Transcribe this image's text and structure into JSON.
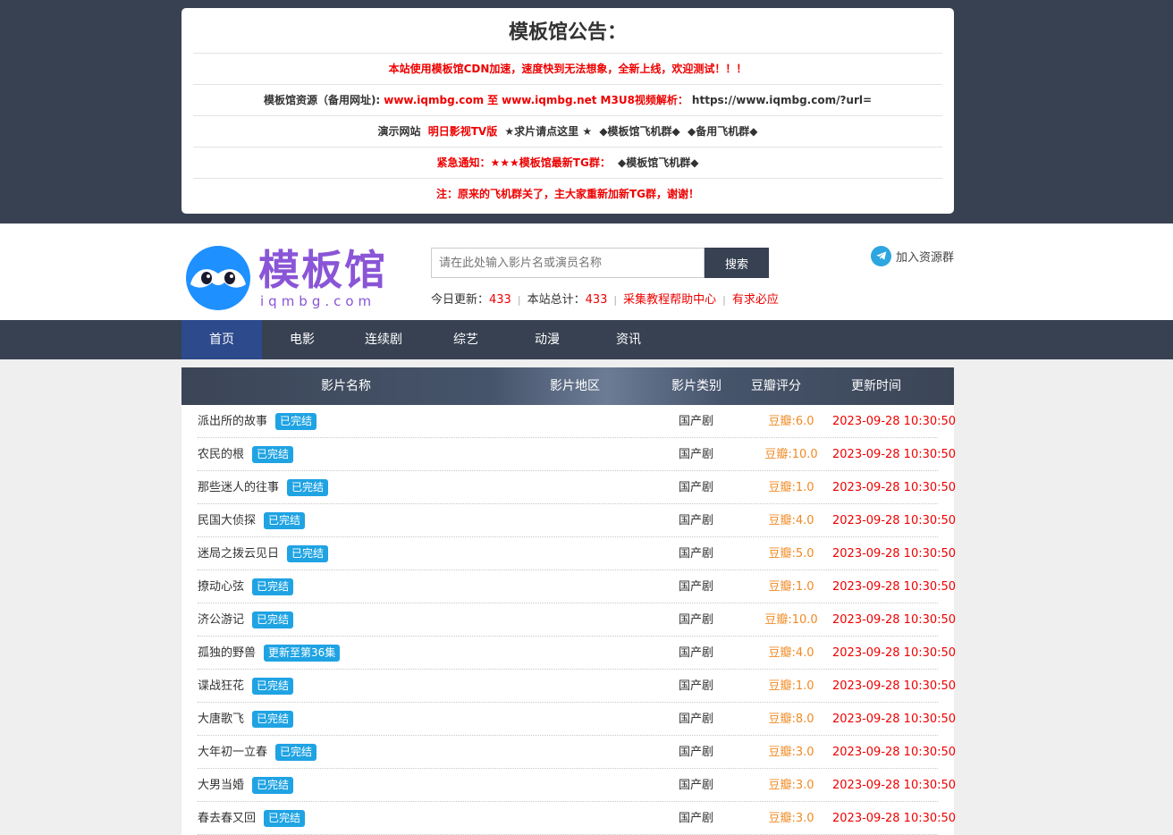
{
  "notice": {
    "title": "模板馆公告：",
    "line1": "本站使用模板馆CDN加速，速度快到无法想象，全新上线，欢迎测试！！！",
    "line2": {
      "prefix": "模板馆资源（备用网址):",
      "url1": "www.iqmbg.com",
      "to": "至",
      "url2": "www.iqmbg.net",
      "m3u8": "M3U8视频解析：",
      "parse_url": "https://www.iqmbg.com/?url="
    },
    "line3": {
      "label": "演示网站",
      "site": "明日影视TV版",
      "request": "★求片请点这里 ★",
      "group1": "◆模板馆飞机群◆",
      "group2": "◆备用飞机群◆"
    },
    "line4": {
      "urgent": "紧急通知：★★★模板馆最新TG群：",
      "group": "◆模板馆飞机群◆"
    },
    "line5": "注：原来的飞机群关了，主大家重新加新TG群，谢谢！"
  },
  "header": {
    "logo_text": "模板馆",
    "logo_sub": "iqmbg.com",
    "search_placeholder": "请在此处输入影片名或演员名称",
    "search_button": "搜索",
    "today_label": "今日更新：",
    "today_count": "433",
    "total_label": "本站总计：",
    "total_count": "433",
    "help_link": "采集教程帮助中心",
    "request_link": "有求必应",
    "join_label": "加入资源群"
  },
  "nav": {
    "items": [
      "首页",
      "电影",
      "连续剧",
      "综艺",
      "动漫",
      "资讯"
    ]
  },
  "table": {
    "headers": {
      "name": "影片名称",
      "region": "影片地区",
      "category": "影片类别",
      "score": "豆瓣评分",
      "time": "更新时间"
    },
    "rows": [
      {
        "title": "派出所的故事",
        "badge": "已完结",
        "category": "国产剧",
        "score": "豆瓣:6.0",
        "time": "2023-09-28 10:30:50"
      },
      {
        "title": "农民的根",
        "badge": "已完结",
        "category": "国产剧",
        "score": "豆瓣:10.0",
        "time": "2023-09-28 10:30:50"
      },
      {
        "title": "那些迷人的往事",
        "badge": "已完结",
        "category": "国产剧",
        "score": "豆瓣:1.0",
        "time": "2023-09-28 10:30:50"
      },
      {
        "title": "民国大侦探",
        "badge": "已完结",
        "category": "国产剧",
        "score": "豆瓣:4.0",
        "time": "2023-09-28 10:30:50"
      },
      {
        "title": "迷局之拨云见日",
        "badge": "已完结",
        "category": "国产剧",
        "score": "豆瓣:5.0",
        "time": "2023-09-28 10:30:50"
      },
      {
        "title": "撩动心弦",
        "badge": "已完结",
        "category": "国产剧",
        "score": "豆瓣:1.0",
        "time": "2023-09-28 10:30:50"
      },
      {
        "title": "济公游记",
        "badge": "已完结",
        "category": "国产剧",
        "score": "豆瓣:10.0",
        "time": "2023-09-28 10:30:50"
      },
      {
        "title": "孤独的野兽",
        "badge": "更新至第36集",
        "category": "国产剧",
        "score": "豆瓣:4.0",
        "time": "2023-09-28 10:30:50"
      },
      {
        "title": "谍战狂花",
        "badge": "已完结",
        "category": "国产剧",
        "score": "豆瓣:1.0",
        "time": "2023-09-28 10:30:50"
      },
      {
        "title": "大唐歌飞",
        "badge": "已完结",
        "category": "国产剧",
        "score": "豆瓣:8.0",
        "time": "2023-09-28 10:30:50"
      },
      {
        "title": "大年初一立春",
        "badge": "已完结",
        "category": "国产剧",
        "score": "豆瓣:3.0",
        "time": "2023-09-28 10:30:50"
      },
      {
        "title": "大男当婚",
        "badge": "已完结",
        "category": "国产剧",
        "score": "豆瓣:3.0",
        "time": "2023-09-28 10:30:50"
      },
      {
        "title": "春去春又回",
        "badge": "已完结",
        "category": "国产剧",
        "score": "豆瓣:3.0",
        "time": "2023-09-28 10:30:50"
      }
    ]
  }
}
